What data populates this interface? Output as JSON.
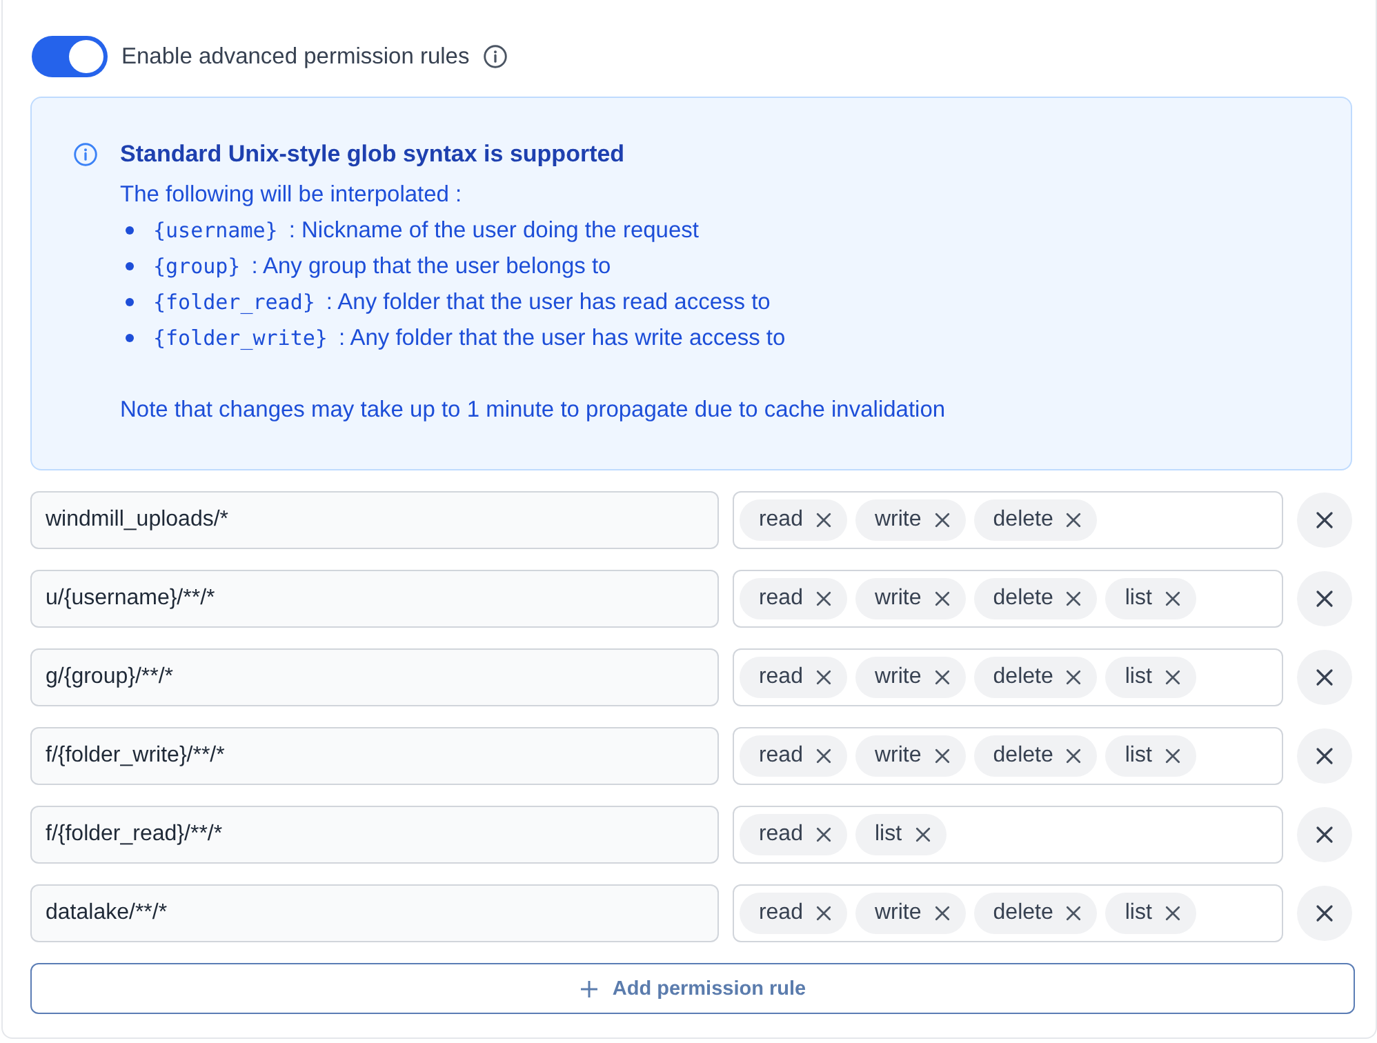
{
  "toggle": {
    "label": "Enable advanced permission rules",
    "on": true
  },
  "info": {
    "title": "Standard Unix-style glob syntax is supported",
    "intro": "The following will be interpolated :",
    "variables": [
      {
        "code": "{username}",
        "description": ": Nickname of the user doing the request"
      },
      {
        "code": "{group}",
        "description": ": Any group that the user belongs to"
      },
      {
        "code": "{folder_read}",
        "description": ": Any folder that the user has read access to"
      },
      {
        "code": "{folder_write}",
        "description": ": Any folder that the user has write access to"
      }
    ],
    "note": "Note that changes may take up to 1 minute to propagate due to cache invalidation"
  },
  "rules": [
    {
      "path": "windmill_uploads/*",
      "permissions": [
        "read",
        "write",
        "delete"
      ]
    },
    {
      "path": "u/{username}/**/*",
      "permissions": [
        "read",
        "write",
        "delete",
        "list"
      ]
    },
    {
      "path": "g/{group}/**/*",
      "permissions": [
        "read",
        "write",
        "delete",
        "list"
      ]
    },
    {
      "path": "f/{folder_write}/**/*",
      "permissions": [
        "read",
        "write",
        "delete",
        "list"
      ]
    },
    {
      "path": "f/{folder_read}/**/*",
      "permissions": [
        "read",
        "list"
      ]
    },
    {
      "path": "datalake/**/*",
      "permissions": [
        "read",
        "write",
        "delete",
        "list"
      ]
    }
  ],
  "add_button": "Add permission rule"
}
